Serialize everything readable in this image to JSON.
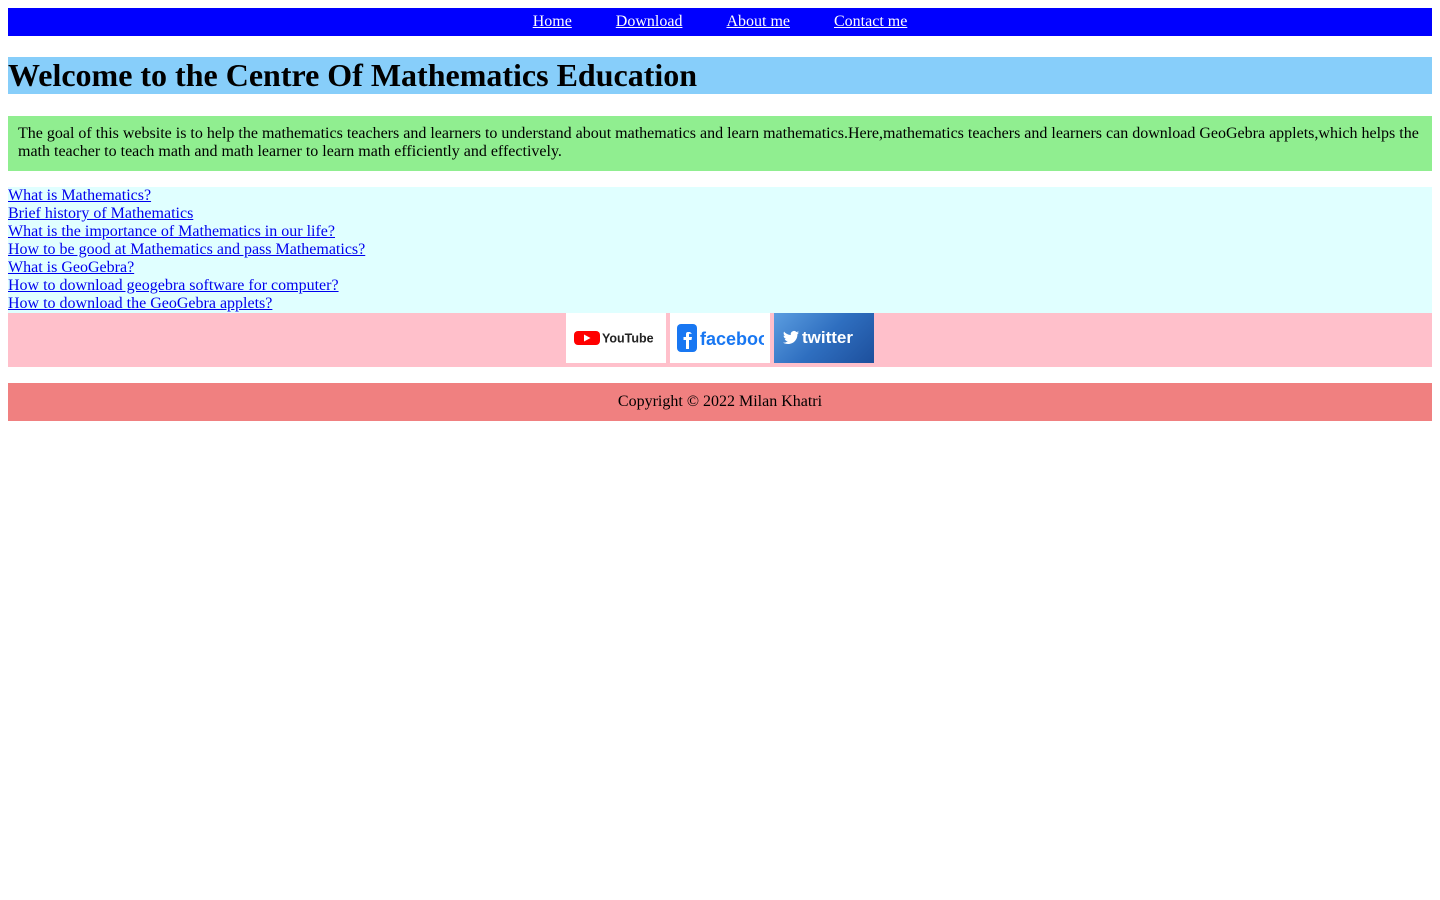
{
  "nav": {
    "items": [
      {
        "label": "Home"
      },
      {
        "label": "Download"
      },
      {
        "label": "About me"
      },
      {
        "label": "Contact me"
      }
    ]
  },
  "welcome": {
    "title": "Welcome to the Centre Of Mathematics Education"
  },
  "intro": {
    "text": "The goal of this website is to help the mathematics teachers and learners to understand about mathematics and learn mathematics.Here,mathematics teachers and learners can download GeoGebra applets,which helps the math teacher to teach math and math learner to learn math efficiently and effectively."
  },
  "links": [
    {
      "label": "What is Mathematics?"
    },
    {
      "label": "Brief history of Mathematics"
    },
    {
      "label": "What is the importance of Mathematics in our life?"
    },
    {
      "label": "How to be good at Mathematics and pass Mathematics?"
    },
    {
      "label": "What is GeoGebra?"
    },
    {
      "label": "How to download geogebra software for computer?"
    },
    {
      "label": "How to download the GeoGebra applets?"
    }
  ],
  "social": [
    {
      "label": "YouTube",
      "icon": "youtube-logo-icon"
    },
    {
      "label": "facebook",
      "icon": "facebook-logo-icon"
    },
    {
      "label": "twitter",
      "icon": "twitter-logo-icon"
    }
  ],
  "footer": {
    "copyright": "Copyright © 2022 Milan Khatri"
  },
  "colors": {
    "nav_bg": "#0000ff",
    "welcome_bg": "#87cefa",
    "intro_bg": "#90ee90",
    "links_bg": "#e0ffff",
    "social_bg": "#ffc0cb",
    "footer_bg": "#f08080"
  }
}
